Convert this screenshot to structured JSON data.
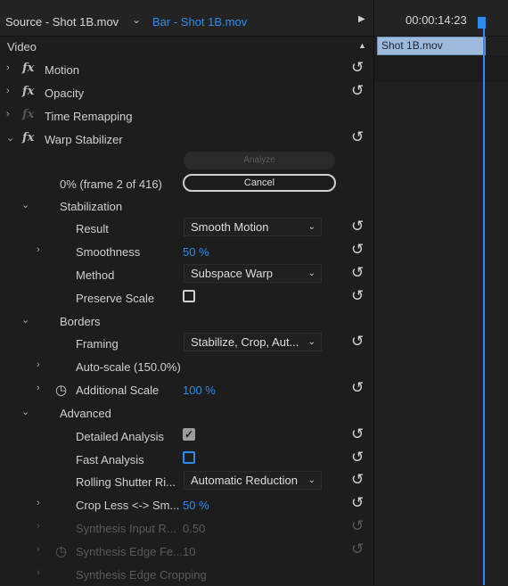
{
  "header": {
    "source_tab": "Source - Shot 1B.mov",
    "active_tab": "Bar - Shot 1B.mov",
    "timecode": "00:00:14:23"
  },
  "timeline": {
    "clip_label": "Shot 1B.mov"
  },
  "effects": {
    "section_title": "Video",
    "motion": "Motion",
    "opacity": "Opacity",
    "time_remapping": "Time Remapping",
    "warp_stabilizer": "Warp Stabilizer"
  },
  "warp": {
    "analyze_label": "Analyze",
    "progress": "0% (frame 2 of 416)",
    "cancel_label": "Cancel",
    "stabilization": {
      "title": "Stabilization",
      "result_label": "Result",
      "result_value": "Smooth Motion",
      "smoothness_label": "Smoothness",
      "smoothness_value": "50 %",
      "method_label": "Method",
      "method_value": "Subspace Warp",
      "preserve_scale_label": "Preserve Scale",
      "preserve_scale_checked": false
    },
    "borders": {
      "title": "Borders",
      "framing_label": "Framing",
      "framing_value": "Stabilize, Crop, Aut...",
      "auto_scale_label": "Auto-scale (150.0%)",
      "additional_scale_label": "Additional Scale",
      "additional_scale_value": "100 %"
    },
    "advanced": {
      "title": "Advanced",
      "detailed_analysis_label": "Detailed Analysis",
      "detailed_analysis_checked": true,
      "fast_analysis_label": "Fast Analysis",
      "fast_analysis_checked": false,
      "rolling_shutter_label": "Rolling Shutter Ri...",
      "rolling_shutter_value": "Automatic Reduction",
      "crop_less_label": "Crop Less <-> Sm...",
      "crop_less_value": "50 %",
      "synthesis_input_label": "Synthesis Input R...",
      "synthesis_input_value": "0.50",
      "synthesis_edge_feather_label": "Synthesis Edge Fe...",
      "synthesis_edge_feather_value": "10",
      "synthesis_edge_cropping_label": "Synthesis Edge Cropping"
    }
  },
  "colors": {
    "accent": "#2d8ceb",
    "clip": "#9db9db",
    "panel": "#1d1d1d"
  }
}
